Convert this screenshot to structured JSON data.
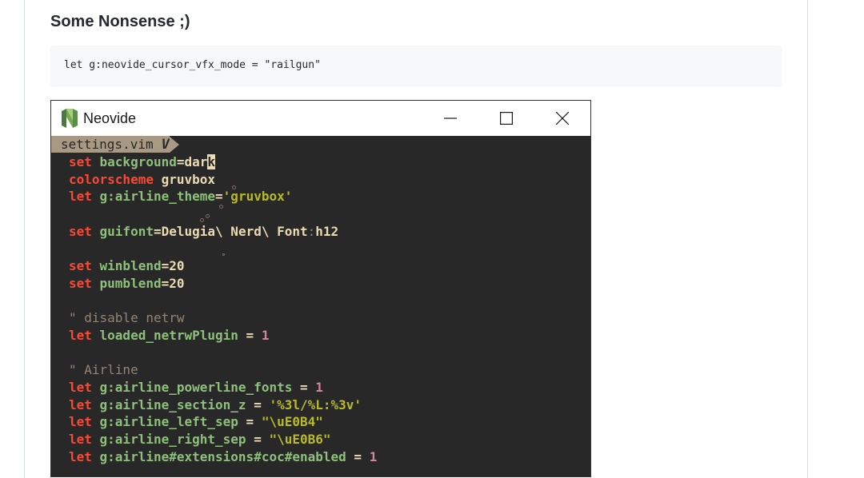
{
  "section": {
    "title": "Some Nonsense ;)"
  },
  "code_block": {
    "text": "let g:neovide_cursor_vfx_mode = \"railgun\""
  },
  "window": {
    "title": "Neovide",
    "icon": "neovide-logo",
    "buttons": {
      "minimize": "minimize-icon",
      "maximize": "maximize-icon",
      "close": "close-icon"
    }
  },
  "editor": {
    "tab": {
      "filename": "settings.vim",
      "icon_glyph": "V"
    },
    "lines": [
      [
        {
          "t": "kw",
          "s": "set "
        },
        {
          "t": "var",
          "s": "background"
        },
        {
          "t": "op",
          "s": "="
        },
        {
          "t": "val",
          "s": "dar"
        },
        {
          "t": "cursor",
          "s": "k"
        }
      ],
      [
        {
          "t": "kw",
          "s": "colorscheme "
        },
        {
          "t": "val",
          "s": "gruvbox"
        }
      ],
      [
        {
          "t": "kw",
          "s": "let "
        },
        {
          "t": "var",
          "s": "g:airline_theme"
        },
        {
          "t": "op",
          "s": "="
        },
        {
          "t": "str",
          "s": "'gruvbox'"
        }
      ],
      [],
      [
        {
          "t": "kw",
          "s": "set "
        },
        {
          "t": "var",
          "s": "guifont"
        },
        {
          "t": "op",
          "s": "="
        },
        {
          "t": "val",
          "s": "Delugia\\ Nerd\\ Font"
        },
        {
          "t": "cmt",
          "s": ":"
        },
        {
          "t": "val",
          "s": "h12"
        }
      ],
      [],
      [
        {
          "t": "kw",
          "s": "set "
        },
        {
          "t": "var",
          "s": "winblend"
        },
        {
          "t": "op",
          "s": "="
        },
        {
          "t": "val",
          "s": "20"
        }
      ],
      [
        {
          "t": "kw",
          "s": "set "
        },
        {
          "t": "var",
          "s": "pumblend"
        },
        {
          "t": "op",
          "s": "="
        },
        {
          "t": "val",
          "s": "20"
        }
      ],
      [],
      [
        {
          "t": "cmt",
          "s": "\" disable netrw"
        }
      ],
      [
        {
          "t": "kw",
          "s": "let "
        },
        {
          "t": "var",
          "s": "loaded_netrwPlugin"
        },
        {
          "t": "op",
          "s": " = "
        },
        {
          "t": "num",
          "s": "1"
        }
      ],
      [],
      [
        {
          "t": "cmt",
          "s": "\" Airline"
        }
      ],
      [
        {
          "t": "kw",
          "s": "let "
        },
        {
          "t": "var",
          "s": "g:airline_powerline_fonts"
        },
        {
          "t": "op",
          "s": " = "
        },
        {
          "t": "num",
          "s": "1"
        }
      ],
      [
        {
          "t": "kw",
          "s": "let "
        },
        {
          "t": "var",
          "s": "g:airline_section_z"
        },
        {
          "t": "op",
          "s": " = "
        },
        {
          "t": "str",
          "s": "'%3l/%L:%3v'"
        }
      ],
      [
        {
          "t": "kw",
          "s": "let "
        },
        {
          "t": "var",
          "s": "g:airline_left_sep"
        },
        {
          "t": "op",
          "s": " = "
        },
        {
          "t": "str",
          "s": "\"\\uE0B4\""
        }
      ],
      [
        {
          "t": "kw",
          "s": "let "
        },
        {
          "t": "var",
          "s": "g:airline_right_sep"
        },
        {
          "t": "op",
          "s": " = "
        },
        {
          "t": "str",
          "s": "\"\\uE0B6\""
        }
      ],
      [
        {
          "t": "kw",
          "s": "let "
        },
        {
          "t": "var",
          "s": "g:airline#extensions#coc#enabled"
        },
        {
          "t": "op",
          "s": " = "
        },
        {
          "t": "num",
          "s": "1"
        }
      ]
    ]
  },
  "colors": {
    "editor_bg": "#282828",
    "keyword": "#fb4934",
    "variable": "#8ec07c",
    "string": "#b8bb26",
    "number": "#d3869b",
    "comment": "#928374",
    "foreground": "#ebdbb2",
    "tab_bg": "#a89984"
  }
}
